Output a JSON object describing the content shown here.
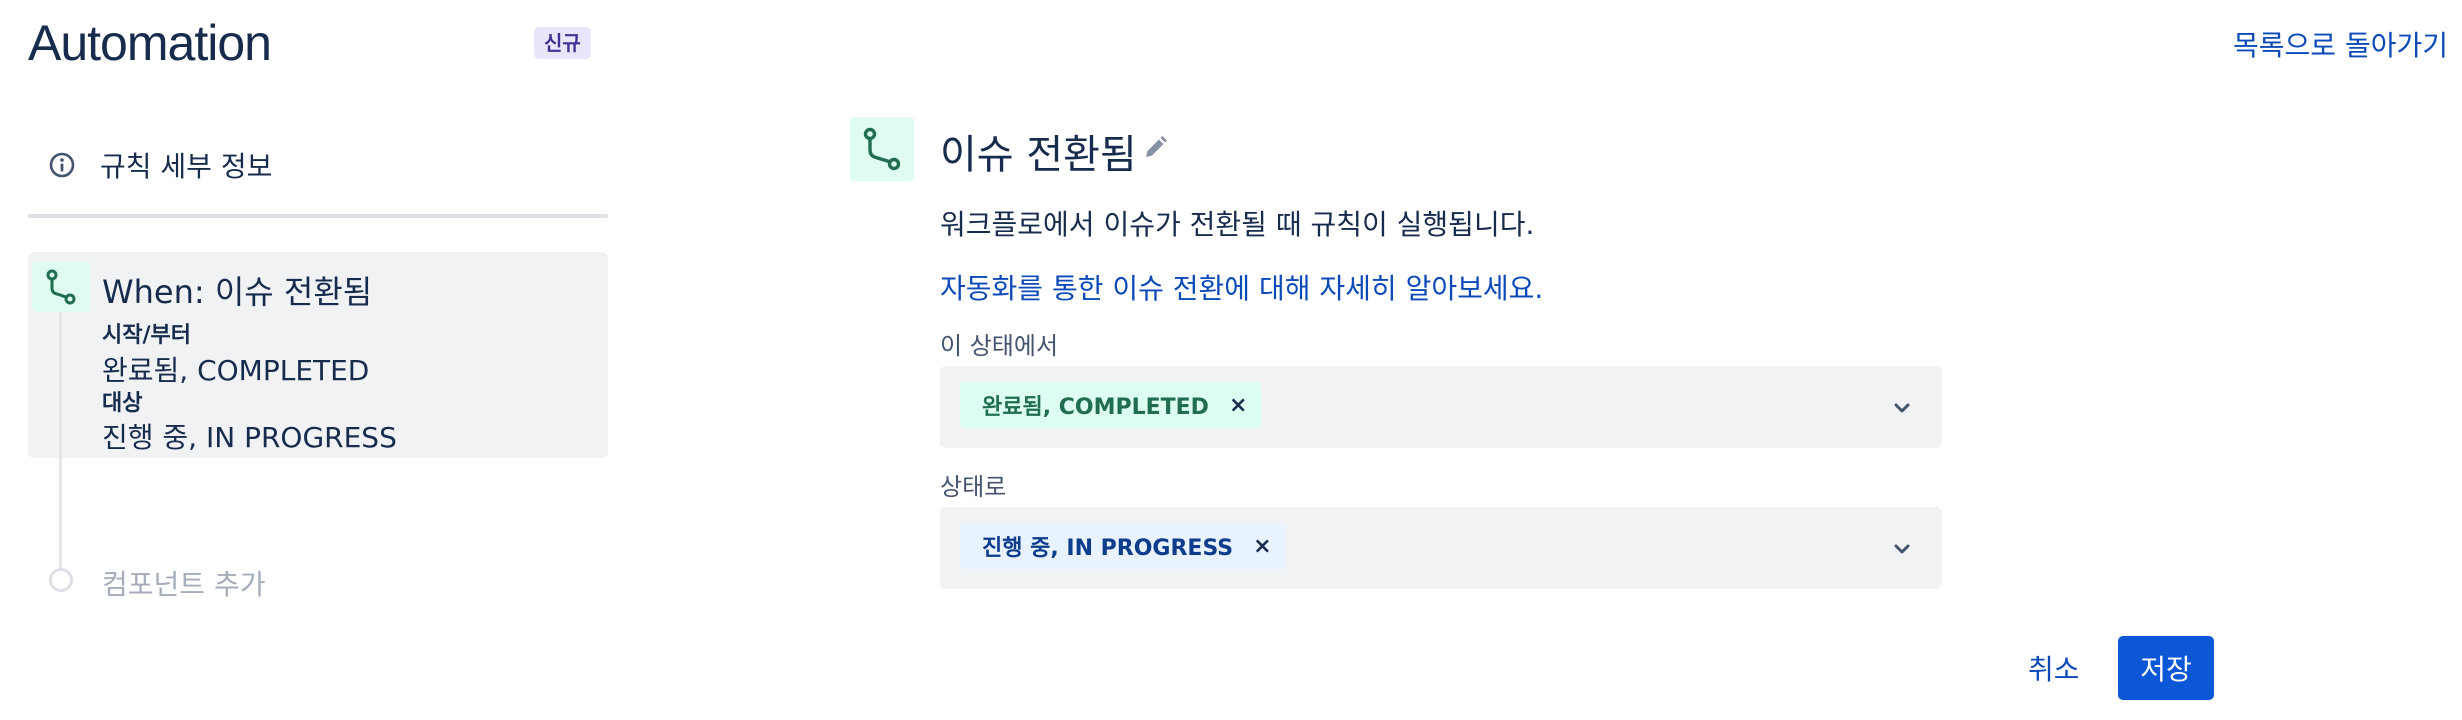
{
  "header": {
    "title": "Automation",
    "badge": "신규",
    "back_link": "목록으로 돌아가기"
  },
  "sidebar": {
    "rule_details": {
      "icon": "info-icon",
      "label": "규칙 세부 정보"
    },
    "trigger": {
      "icon": "transition-icon",
      "title": "When: 이슈 전환됨",
      "from_label": "시작/부터",
      "from_value": "완료됨, COMPLETED",
      "to_label": "대상",
      "to_value": "진행 중, IN PROGRESS"
    },
    "add_component": "컴포넌트 추가"
  },
  "main": {
    "icon": "transition-icon",
    "title": "이슈 전환됨",
    "edit_icon": "pencil-icon",
    "description": "워크플로에서 이슈가 전환될 때 규칙이 실행됩니다.",
    "learn_more": "자동화를 통한 이슈 전환에 대해 자세히 알아보세요.",
    "from_field": {
      "label": "이 상태에서",
      "chip": "완료됨, COMPLETED",
      "chip_color": "#dcfff1"
    },
    "to_field": {
      "label": "상태로",
      "chip": "진행 중, IN PROGRESS",
      "chip_color": "#e9f2ff"
    },
    "remove_symbol": "×",
    "cancel": "취소",
    "save": "저장"
  },
  "colors": {
    "accent": "#0c57d6",
    "link": "#0c4ab8",
    "trigger_green": "#216e4e"
  }
}
